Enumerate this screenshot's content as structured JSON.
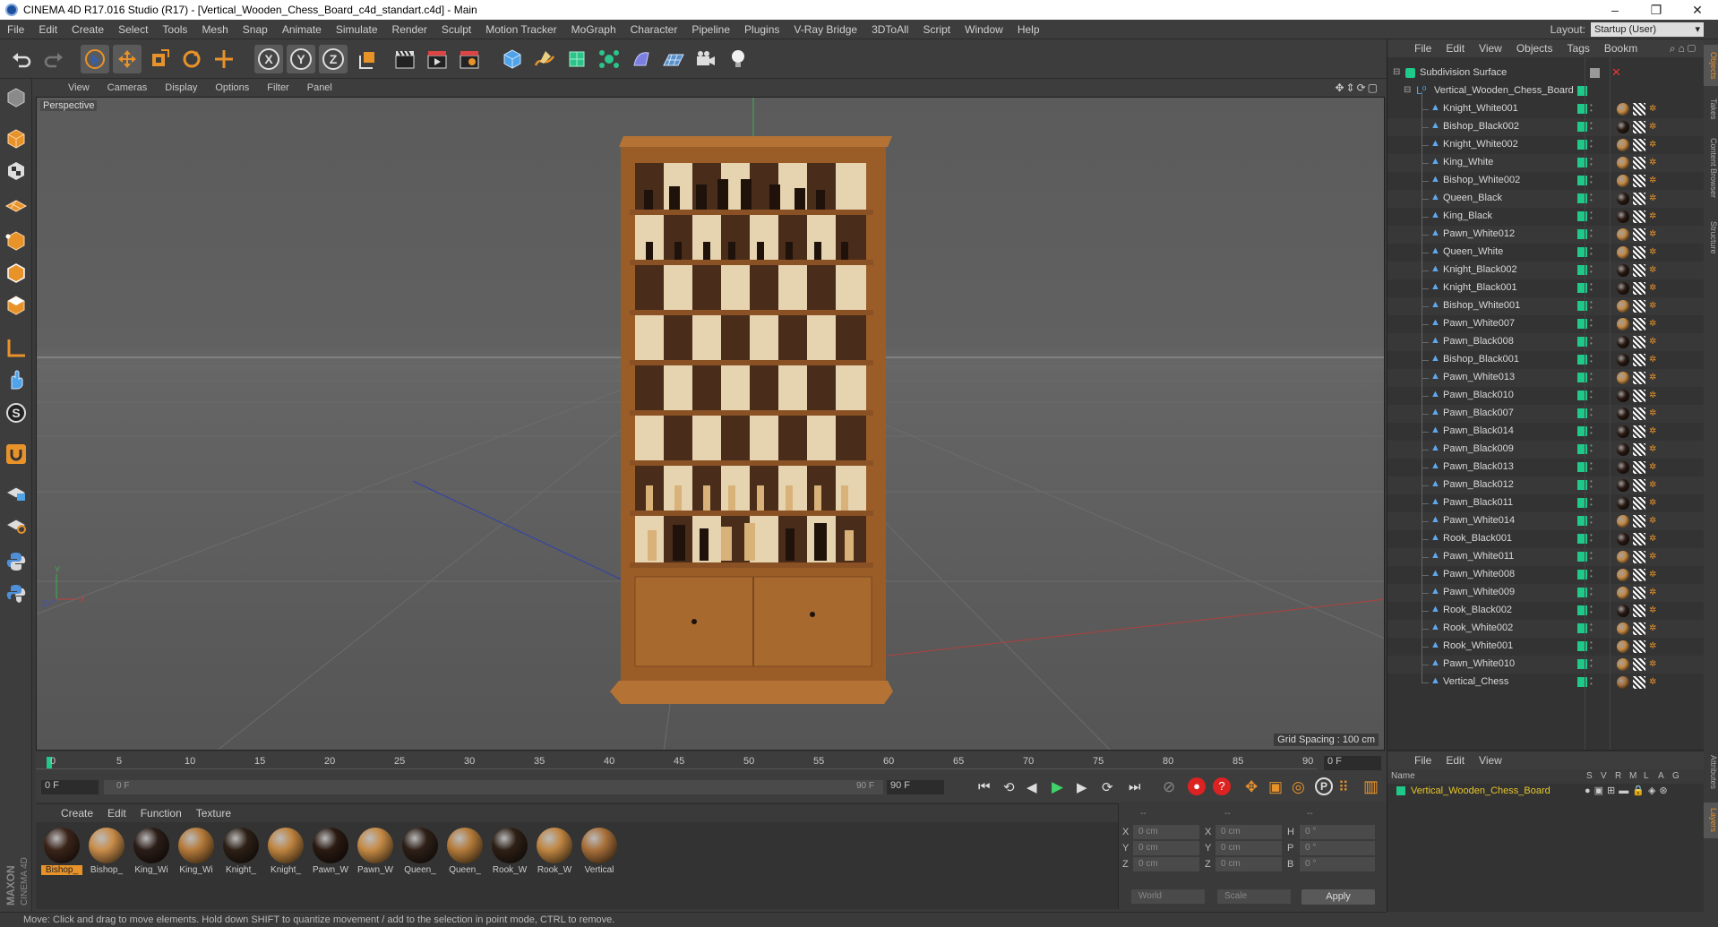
{
  "window": {
    "title": "CINEMA 4D R17.016 Studio (R17) - [Vertical_Wooden_Chess_Board_c4d_standart.c4d] - Main",
    "controls": [
      "–",
      "❐",
      "✕"
    ]
  },
  "menu": [
    "File",
    "Edit",
    "Create",
    "Select",
    "Tools",
    "Mesh",
    "Snap",
    "Animate",
    "Simulate",
    "Render",
    "Sculpt",
    "Motion Tracker",
    "MoGraph",
    "Character",
    "Pipeline",
    "Plugins",
    "V-Ray Bridge",
    "3DToAll",
    "Script",
    "Window",
    "Help"
  ],
  "layout": {
    "label": "Layout:",
    "value": "Startup (User)"
  },
  "toolbar": {
    "axis_x": "X",
    "axis_y": "Y",
    "axis_z": "Z"
  },
  "viewport": {
    "menu": [
      "View",
      "Cameras",
      "Display",
      "Options",
      "Filter",
      "Panel"
    ],
    "label": "Perspective",
    "grid_spacing": "Grid Spacing : 100 cm"
  },
  "timeline": {
    "ticks": [
      "0",
      "5",
      "10",
      "15",
      "20",
      "25",
      "30",
      "35",
      "40",
      "45",
      "50",
      "55",
      "60",
      "65",
      "70",
      "75",
      "80",
      "85",
      "90"
    ],
    "current_frame": "0 F",
    "start": "0 F",
    "range_start": "0 F",
    "range_end": "90 F",
    "end": "90 F"
  },
  "materials": {
    "menu": [
      "Create",
      "Edit",
      "Function",
      "Texture"
    ],
    "items": [
      {
        "label": "Bishop_",
        "color": "#3a2419",
        "selected": true
      },
      {
        "label": "Bishop_",
        "color": "#c98d4a"
      },
      {
        "label": "King_Wi",
        "color": "#2b1d17"
      },
      {
        "label": "King_Wi",
        "color": "#b57a3a"
      },
      {
        "label": "Knight_",
        "color": "#2d2016"
      },
      {
        "label": "Knight_",
        "color": "#bf843f"
      },
      {
        "label": "Pawn_W",
        "color": "#2a1a12"
      },
      {
        "label": "Pawn_W",
        "color": "#c58a45"
      },
      {
        "label": "Queen_",
        "color": "#2e2018"
      },
      {
        "label": "Queen_",
        "color": "#b47b3a"
      },
      {
        "label": "Rook_W",
        "color": "#2e2016"
      },
      {
        "label": "Rook_W",
        "color": "#c08642"
      },
      {
        "label": "Vertical",
        "color": "#a8703a"
      }
    ]
  },
  "coords": {
    "header": [
      "--",
      "--",
      "--"
    ],
    "rows": [
      {
        "a": "X",
        "av": "0 cm",
        "b": "X",
        "bv": "0 cm",
        "c": "H",
        "cv": "0 °"
      },
      {
        "a": "Y",
        "av": "0 cm",
        "b": "Y",
        "bv": "0 cm",
        "c": "P",
        "cv": "0 °"
      },
      {
        "a": "Z",
        "av": "0 cm",
        "b": "Z",
        "bv": "0 cm",
        "c": "B",
        "cv": "0 °"
      }
    ],
    "mode1": "World",
    "mode2": "Scale",
    "apply": "Apply"
  },
  "status": "Move: Click and drag to move elements. Hold down SHIFT to quantize movement / add to the selection in point mode, CTRL to remove.",
  "objects": {
    "menu": [
      "File",
      "Edit",
      "View",
      "Objects",
      "Tags",
      "Bookm"
    ],
    "root": "Subdivision Surface",
    "group": "Vertical_Wooden_Chess_Board",
    "items": [
      "Knight_White001",
      "Bishop_Black002",
      "Knight_White002",
      "King_White",
      "Bishop_White002",
      "Queen_Black",
      "King_Black",
      "Pawn_White012",
      "Queen_White",
      "Knight_Black002",
      "Knight_Black001",
      "Bishop_White001",
      "Pawn_White007",
      "Pawn_Black008",
      "Bishop_Black001",
      "Pawn_White013",
      "Pawn_Black010",
      "Pawn_Black007",
      "Pawn_Black014",
      "Pawn_Black009",
      "Pawn_Black013",
      "Pawn_Black012",
      "Pawn_Black011",
      "Pawn_White014",
      "Rook_Black001",
      "Pawn_White011",
      "Pawn_White008",
      "Pawn_White009",
      "Rook_Black002",
      "Rook_White002",
      "Rook_White001",
      "Pawn_White010",
      "Vertical_Chess"
    ]
  },
  "layers": {
    "menu": [
      "File",
      "Edit",
      "View"
    ],
    "columns": [
      "Name",
      "S",
      "V",
      "R",
      "M",
      "L",
      "A",
      "G"
    ],
    "item": "Vertical_Wooden_Chess_Board"
  },
  "side_tabs": [
    "Objects",
    "Takes",
    "Content Browser",
    "Structure",
    "Attributes",
    "Layers"
  ],
  "logo": "MAXON CINEMA 4D"
}
